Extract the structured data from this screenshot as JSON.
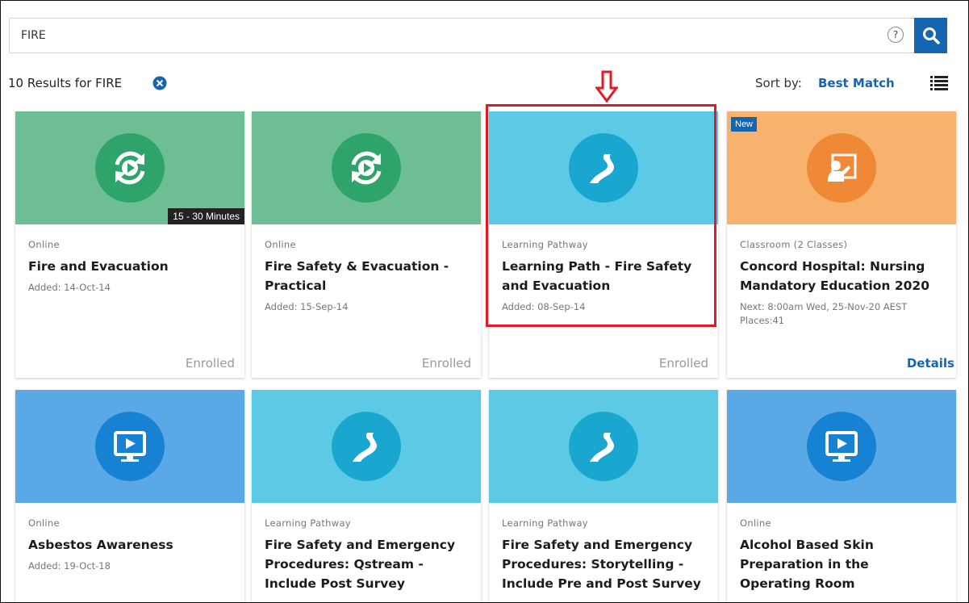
{
  "search": {
    "value": "FIRE",
    "help_glyph": "?"
  },
  "results": {
    "summary": "10 Results for FIRE",
    "sort_label": "Sort by:",
    "sort_value": "Best Match"
  },
  "cards": [
    {
      "type": "Online",
      "title": "Fire and Evacuation",
      "added": "Added: 14-Oct-14",
      "status": "Enrolled",
      "duration": "15 - 30 Minutes",
      "icon": "replay-icon",
      "color": "green"
    },
    {
      "type": "Online",
      "title": "Fire Safety & Evacuation - Practical",
      "added": "Added: 15-Sep-14",
      "status": "Enrolled",
      "icon": "replay-icon",
      "color": "green"
    },
    {
      "type": "Learning Pathway",
      "title": "Learning Path - Fire Safety and Evacuation",
      "added": "Added: 08-Sep-14",
      "status": "Enrolled",
      "icon": "pathway-road-icon",
      "color": "teal"
    },
    {
      "type": "Classroom (2 Classes)",
      "title": "Concord Hospital: Nursing Mandatory Education 2020",
      "added": "Next: 8:00am Wed, 25-Nov-20 AEST",
      "places": "Places:41",
      "badge": "New",
      "action": "Details",
      "icon": "classroom-presenter-icon",
      "color": "orange"
    },
    {
      "type": "Online",
      "title": "Asbestos Awareness",
      "added": "Added: 19-Oct-18",
      "icon": "video-monitor-icon",
      "color": "blue"
    },
    {
      "type": "Learning Pathway",
      "title": "Fire Safety and Emergency Procedures: Qstream - Include Post Survey",
      "icon": "pathway-road-icon",
      "color": "teal"
    },
    {
      "type": "Learning Pathway",
      "title": "Fire Safety and Emergency Procedures: Storytelling - Include Pre and Post Survey",
      "icon": "pathway-road-icon",
      "color": "teal"
    },
    {
      "type": "Online",
      "title": "Alcohol Based Skin Preparation in the Operating Room",
      "icon": "video-monitor-icon",
      "color": "blue"
    }
  ],
  "colors": {
    "accent": "#1565b0",
    "highlight": "#e11b22",
    "green_thumb": "#6dbd95",
    "teal_thumb": "#5ccae4",
    "blue_thumb": "#5aa9e6",
    "orange_thumb": "#f7b36e"
  }
}
